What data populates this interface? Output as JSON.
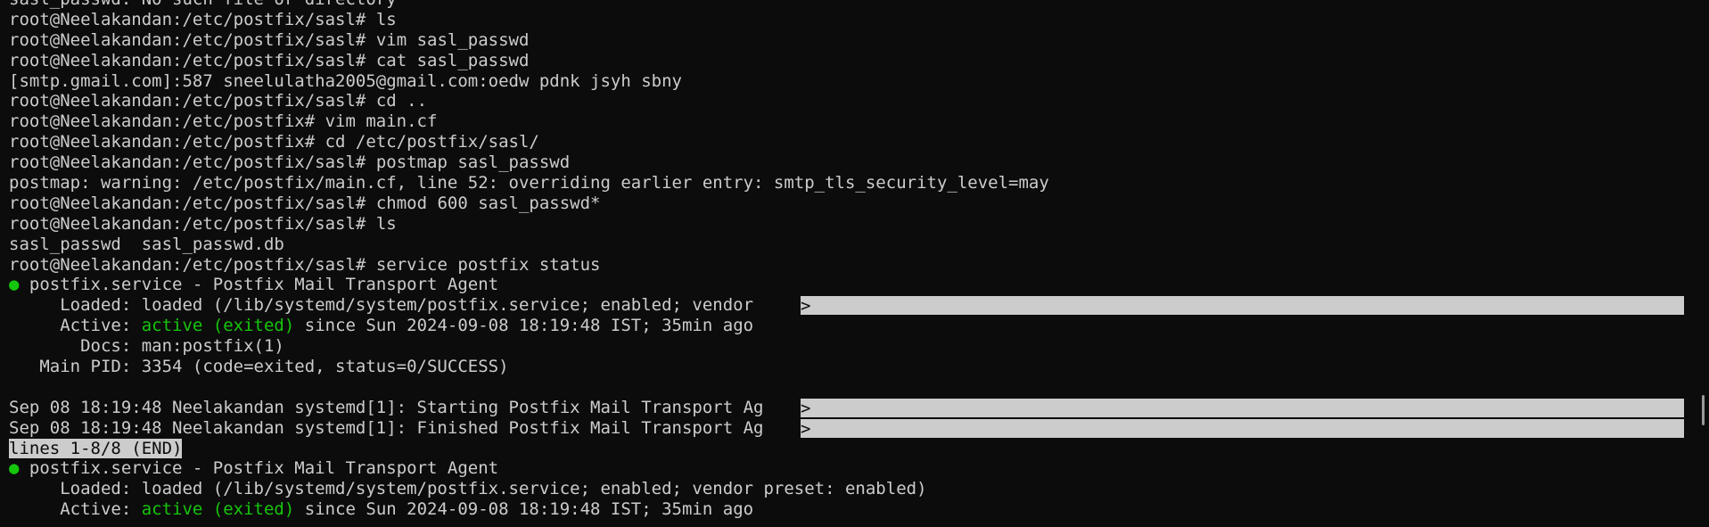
{
  "terminal": {
    "lines": [
      {
        "text": "sasl_passwd: No such file or directory"
      },
      {
        "prompt": "root@Neelakandan:/etc/postfix/sasl# ",
        "text": "ls"
      },
      {
        "prompt": "root@Neelakandan:/etc/postfix/sasl# ",
        "text": "vim sasl_passwd"
      },
      {
        "prompt": "root@Neelakandan:/etc/postfix/sasl# ",
        "text": "cat sasl_passwd"
      },
      {
        "text": "[smtp.gmail.com]:587 sneelulatha2005@gmail.com:oedw pdnk jsyh sbny"
      },
      {
        "prompt": "root@Neelakandan:/etc/postfix/sasl# ",
        "text": "cd .."
      },
      {
        "prompt": "root@Neelakandan:/etc/postfix# ",
        "text": "vim main.cf"
      },
      {
        "prompt": "root@Neelakandan:/etc/postfix# ",
        "text": "cd /etc/postfix/sasl/"
      },
      {
        "prompt": "root@Neelakandan:/etc/postfix/sasl# ",
        "text": "postmap sasl_passwd"
      },
      {
        "text": "postmap: warning: /etc/postfix/main.cf, line 52: overriding earlier entry: smtp_tls_security_level=may"
      },
      {
        "prompt": "root@Neelakandan:/etc/postfix/sasl# ",
        "text": "chmod 600 sasl_passwd*"
      },
      {
        "prompt": "root@Neelakandan:/etc/postfix/sasl# ",
        "text": "ls"
      },
      {
        "text": "sasl_passwd  sasl_passwd.db"
      },
      {
        "prompt": "root@Neelakandan:/etc/postfix/sasl# ",
        "text": "service postfix status"
      },
      {
        "dot": "●",
        "text": " postfix.service - Postfix Mail Transport Agent"
      },
      {
        "text": "     Loaded: loaded (/lib/systemd/system/postfix.service; enabled; vendor ",
        "overflow": ">"
      },
      {
        "text": "     Active: ",
        "green": "active (exited)",
        "rest": " since Sun 2024-09-08 18:19:48 IST; 35min ago"
      },
      {
        "text": "       Docs: man:postfix(1)"
      },
      {
        "text": "   Main PID: 3354 (code=exited, status=0/SUCCESS)"
      },
      {
        "text": ""
      },
      {
        "text": "Sep 08 18:19:48 Neelakandan systemd[1]: Starting Postfix Mail Transport Ag",
        "overflow": ">"
      },
      {
        "text": "Sep 08 18:19:48 Neelakandan systemd[1]: Finished Postfix Mail Transport Ag",
        "overflow": ">"
      },
      {
        "pager": "lines 1-8/8 (END)"
      },
      {
        "dot": "●",
        "text": " postfix.service - Postfix Mail Transport Agent"
      },
      {
        "text": "     Loaded: loaded (/lib/systemd/system/postfix.service; enabled; vendor preset: enabled)"
      },
      {
        "text": "     Active: ",
        "green": "active (exited)",
        "rest": " since Sun 2024-09-08 18:19:48 IST; 35min ago"
      }
    ]
  },
  "colors": {
    "background": "#0c0c0c",
    "foreground": "#cccccc",
    "status_green": "#16c60c",
    "highlight": "#cccccc"
  }
}
